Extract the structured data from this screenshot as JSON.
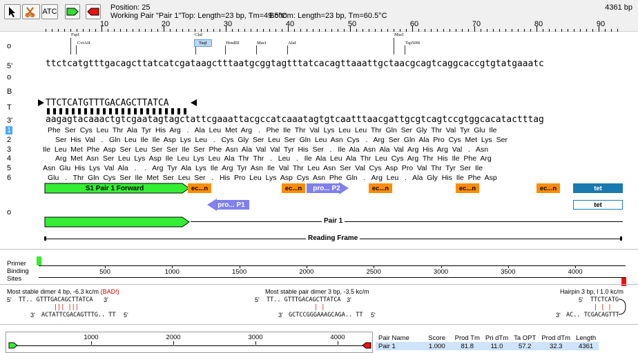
{
  "toolbar": {
    "atc_label": "ATC",
    "position_text": "Position: 25",
    "working_pair_text": "Working Pair \"Pair 1\"Top: Length=23 bp, Tm=49.5°C",
    "bottom_text": "Bottom: Length=23 bp, Tm=60.5°C",
    "total_bp": "4361 bp"
  },
  "ruler": {
    "labels": [
      "10",
      "20",
      "30",
      "40",
      "50",
      "60",
      "70",
      "80",
      "90"
    ]
  },
  "row_labels": {
    "o1": "o",
    "five": "5'",
    "o2": "o",
    "b": "B",
    "t": "T",
    "three": "3'",
    "f1": "1",
    "f2": "2",
    "f3": "3",
    "f4": "4",
    "f5": "5",
    "f6": "6",
    "o3": "o"
  },
  "sites": [
    {
      "name": "FspI"
    },
    {
      "name": "CviAII"
    },
    {
      "name": "ClaI"
    },
    {
      "name": "TaqI"
    },
    {
      "name": "HindIII"
    },
    {
      "name": "MseI"
    },
    {
      "name": "AluI"
    },
    {
      "name": "MseI"
    },
    {
      "name": "Tsp509I"
    }
  ],
  "sequence": {
    "top": "ttctcatgtttgacagcttatcatcgataagctttaatgcggtagtttatcacagttaaattgctaacgcagtcaggcaccgtgtatgaaatc",
    "primer": "TTCTCATGTTTGACAGCTTATCA",
    "bottom": "aagagtacaaactgtcgaatagtagctattcgaaattacgccatcaaatagtgtcaatttaacgattgcgtcagtccgtggcacatactttag"
  },
  "frames": [
    "Phe  Ser  Cys  Leu  Thr  Ala  Tyr  His  Arg   .   Ala  Leu  Met  Arg   .   Phe  Ile  Thr  Val  Lys  Leu  Leu  Thr  Gln  Ser  Gly  Thr  Val  Tyr  Glu  Ile",
    "Ser  His  Val   .   Gln  Leu  Ile  Ile  Asp  Lys  Leu   .   Cys  Gly  Ser  Leu  Ser  Gln  Leu  Asn  Cys   .   Arg  Ser  Gln  Ala  Pro  Cys  Met  Lys  Ser",
    "Ile  Leu  Met  Phe  Asp  Ser  Leu  Ser  Ser  Ile  Ser  Phe  Asn  Ala  Val  Val  Tyr  His  Ser   .   Ile  Ala  Asn  Ala  Val  Arg  His  Arg  Val   .   Asn",
    "Arg  Met  Asn  Ser  Leu  Lys  Asp  Ile  Leu  Lys  Leu  Ala  Thr  Thr   .   Leu   .   Ile  Ala  Leu  Ala  Thr  Leu  Cys  Arg  Thr  His  Ile  Phe  Arg",
    "Asn  Glu  His  Lys  Val  Ala   .    .   Arg  Tyr  Ala  Lys  Ile  Arg  Tyr  Asn  Ile  Val  Thr  Leu  Asn  Ser  Val  Cys  Asp  Pro  Val  Thr  Tyr  Ser  Ile",
    "Glu   .   Thr  Gln  Cys  Ser  Ile  Met  Ser  Leu  Ser   .   His  Pro  Leu  Lys  Asp  Cys  Asn  Phe  Gln   .   Arg  Leu   .   Ala  Gly  His  Ile  Phe  Asp"
  ],
  "features": {
    "forward_label": "S1 Pair 1 Forward",
    "ecn_label": "ec...n",
    "p2_label": "pro... P2",
    "p1_label": "pro... P1",
    "tet_label": "tet",
    "tet2_label": "tet",
    "pair_label": "Pair 1",
    "reading_frame_label": "Reading Frame"
  },
  "binding": {
    "label_primer": "Primer",
    "label_binding": "Binding",
    "label_sites": "Sites",
    "scale": [
      "500",
      "1000",
      "1500",
      "2000",
      "2500",
      "3000",
      "3500",
      "4000"
    ]
  },
  "dimers": {
    "d1_title": "Most stable dimer 4 bp, -6.3 kc/m",
    "d1_bad": "(BAD!)",
    "d1_top": "TT.. GTTTGACAGCTTATCA",
    "d1_bot": "ACTATTCGACAGTTTG.. TT",
    "d2_title": "Most stable pair dimer 3 bp, -3.5 kc/m",
    "d2_top": "TT.. GTTTGACAGCTTATCA",
    "d2_bot": "GCTCCGGGAAAGCAGA.. TT",
    "d3_title": "Hairpin 3 bp, l 1.0 kc/m",
    "d3_top": "TTCTCATG",
    "d3_bot": "AC.. TCGACAGTTT",
    "five": "5'",
    "three": "3'"
  },
  "bottom_map": {
    "scale": [
      "1000",
      "2000",
      "3000",
      "4000"
    ]
  },
  "pairs_table": {
    "headers": [
      "Pair Name",
      "Score",
      "Prod Tm",
      "Pri dTm",
      "Ta OPT",
      "Prod dTm",
      "Length"
    ],
    "rows": [
      [
        "Pair 1",
        "1.000",
        "81.8",
        "11.0",
        "57.2",
        "32.3",
        "4361"
      ]
    ]
  },
  "colors": {
    "green": "#33dd33",
    "red": "#ee1111",
    "orange": "#ff8c00",
    "blue": "#8080ee",
    "tet": "#1a7ab0"
  }
}
